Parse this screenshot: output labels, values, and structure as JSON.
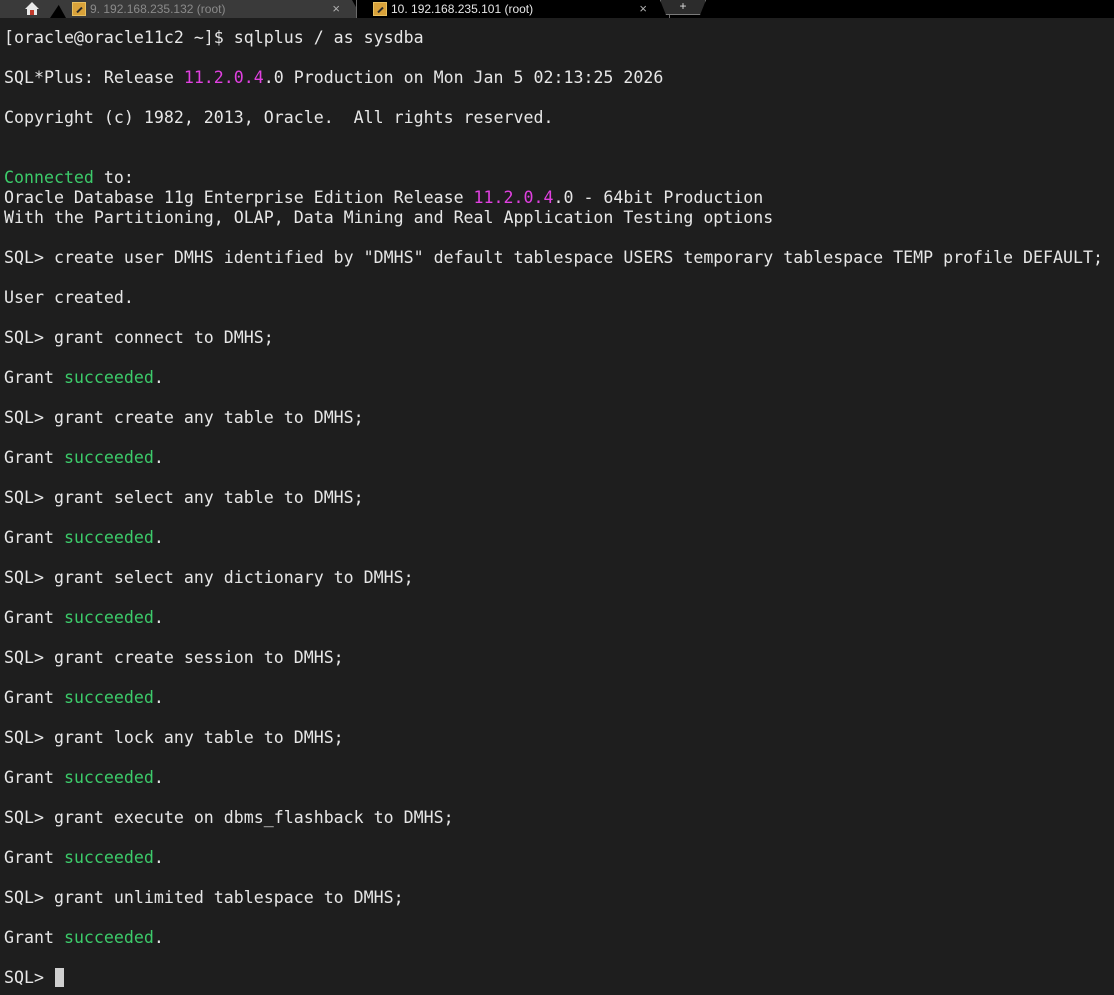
{
  "tabs": [
    {
      "number": "9.",
      "title": "192.168.235.132 (root)",
      "close": "×",
      "active": false
    },
    {
      "number": "10.",
      "title": "192.168.235.101 (root)",
      "close": "×",
      "active": true
    }
  ],
  "new_tab_label": "+",
  "colors": {
    "background": "#1e1e1e",
    "text": "#e6e6e6",
    "green": "#3ccb6a",
    "magenta": "#e040e0"
  },
  "terminal": {
    "line1": "[oracle@oracle11c2 ~]$ sqlplus / as sysdba",
    "line2_pre": "SQL*Plus: Release ",
    "line2_ver": "11.2.0.4",
    "line2_post": ".0 Production on Mon Jan 5 02:13:25 2026",
    "line3": "Copyright (c) 1982, 2013, Oracle.  All rights reserved.",
    "line4_green": "Connected",
    "line4_post": " to:",
    "line5_pre": "Oracle Database 11g Enterprise Edition Release ",
    "line5_ver": "11.2.0.4",
    "line5_post": ".0 - 64bit Production",
    "line6": "With the Partitioning, OLAP, Data Mining and Real Application Testing options",
    "cmd1": "SQL> create user DMHS identified by \"DMHS\" default tablespace USERS temporary tablespace TEMP profile DEFAULT;",
    "res1": "User created.",
    "cmd2": "SQL> grant connect to DMHS;",
    "cmd3": "SQL> grant create any table to DMHS;",
    "cmd4": "SQL> grant select any table to DMHS;",
    "cmd5": "SQL> grant select any dictionary to DMHS;",
    "cmd6": "SQL> grant create session to DMHS;",
    "cmd7": "SQL> grant lock any table to DMHS;",
    "cmd8": "SQL> grant execute on dbms_flashback to DMHS;",
    "cmd9": "SQL> grant unlimited tablespace to DMHS;",
    "grant_pre": "Grant ",
    "grant_word": "succeeded",
    "grant_post": ".",
    "prompt": "SQL> "
  }
}
